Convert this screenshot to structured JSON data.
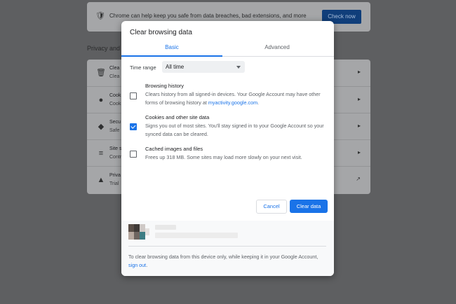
{
  "background": {
    "safety_banner": {
      "text": "Chrome can help keep you safe from data breaches, bad extensions, and more",
      "button": "Check now"
    },
    "section_title": "Privacy and s",
    "rows": [
      {
        "icon": "trash-icon",
        "title": "Clea",
        "subtitle": "Clea"
      },
      {
        "icon": "cookie-icon",
        "title": "Cook",
        "subtitle": "Cook"
      },
      {
        "icon": "shield-icon",
        "title": "Secu",
        "subtitle": "Safe"
      },
      {
        "icon": "sliders-icon",
        "title": "Site s",
        "subtitle": "Contr"
      },
      {
        "icon": "flask-icon",
        "title": "Priva",
        "subtitle": "Trial"
      }
    ]
  },
  "dialog": {
    "title": "Clear browsing data",
    "tabs": [
      {
        "label": "Basic",
        "active": true
      },
      {
        "label": "Advanced",
        "active": false
      }
    ],
    "time_range": {
      "label": "Time range",
      "value": "All time"
    },
    "options": [
      {
        "title": "Browsing history",
        "checked": false,
        "desc_before": "Clears history from all signed-in devices. Your Google Account may have other forms of browsing history at ",
        "desc_link": "myactivity.google.com",
        "desc_after": "."
      },
      {
        "title": "Cookies and other site data",
        "checked": true,
        "desc": "Signs you out of most sites. You'll stay signed in to your Google Account so your synced data can be cleared."
      },
      {
        "title": "Cached images and files",
        "checked": false,
        "desc": "Frees up 318 MB. Some sites may load more slowly on your next visit."
      }
    ],
    "buttons": {
      "cancel": "Cancel",
      "clear": "Clear data"
    },
    "footer": {
      "text_before": "To clear browsing data from this device only, while keeping it in your Google Account, ",
      "link": "sign out",
      "text_after": "."
    }
  },
  "colors": {
    "accent": "#1a73e8",
    "overlay": "#5e5f61"
  }
}
